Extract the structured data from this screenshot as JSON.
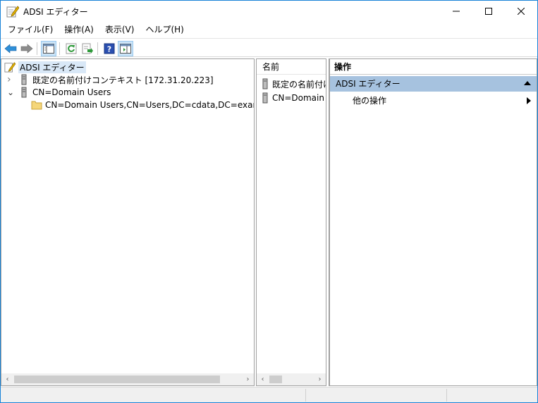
{
  "window": {
    "title": "ADSI エディター",
    "controls": {
      "minimize": "─",
      "maximize": "☐",
      "close": "✕"
    }
  },
  "menu": [
    {
      "label": "ファイル(F)"
    },
    {
      "label": "操作(A)"
    },
    {
      "label": "表示(V)"
    },
    {
      "label": "ヘルプ(H)"
    }
  ],
  "toolbar": {
    "buttons": [
      "back-icon",
      "forward-icon",
      "show-hide-tree-icon",
      "refresh-icon",
      "export-list-icon",
      "help-icon",
      "show-hide-action-pane-icon"
    ]
  },
  "tree": {
    "root": "ADSI エディター",
    "items": [
      {
        "label": "既定の名前付けコンテキスト [172.31.20.223]",
        "expander": "›"
      },
      {
        "label": "CN=Domain Users",
        "expander": "⌄"
      },
      {
        "label": "CN=Domain Users,CN=Users,DC=cdata,DC=example,DC"
      }
    ]
  },
  "list": {
    "column": "名前",
    "rows": [
      {
        "label": "既定の名前付け"
      },
      {
        "label": "CN=Domain U"
      }
    ]
  },
  "actions": {
    "header": "操作",
    "section": "ADSI エディター",
    "item": "他の操作"
  },
  "scroll": {
    "left": "‹",
    "right": "›"
  },
  "colors": {
    "accent": "#1883d7",
    "section_bg": "#a6c2df",
    "selection": "#d9e8f7"
  }
}
